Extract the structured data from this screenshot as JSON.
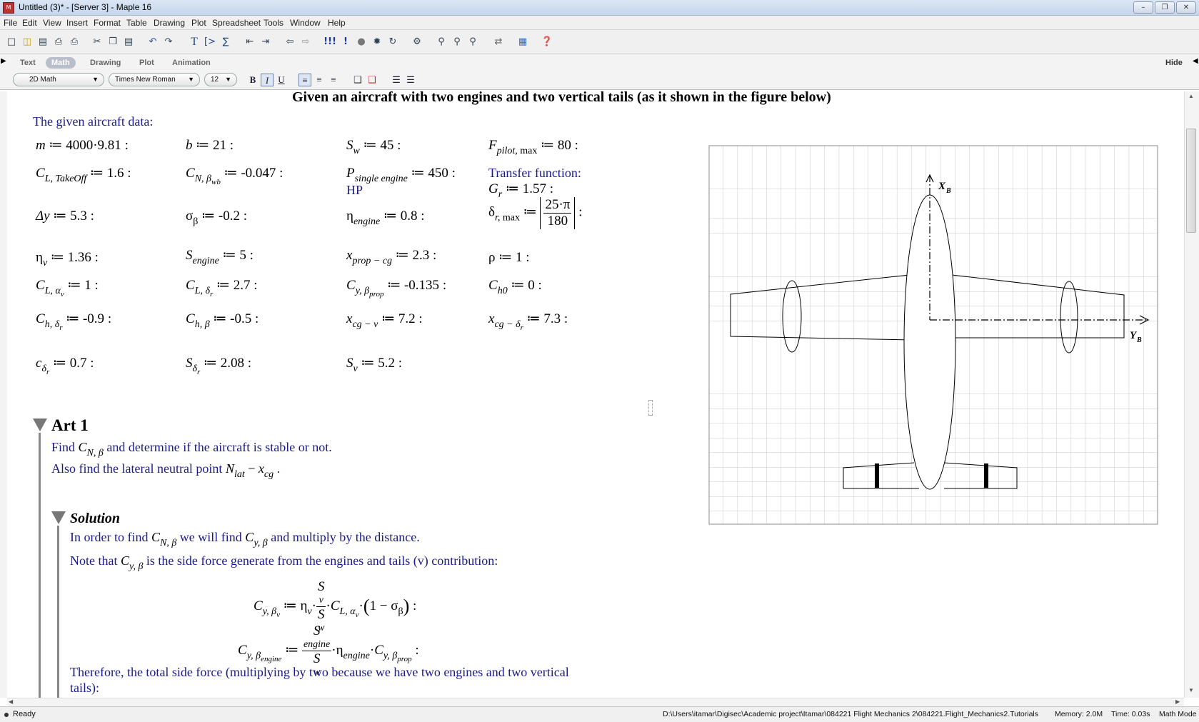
{
  "window": {
    "title": "Untitled (3)* - [Server 3] - Maple 16",
    "minimize": "–",
    "restore": "❐",
    "close": "✕"
  },
  "menu": [
    "File",
    "Edit",
    "View",
    "Insert",
    "Format",
    "Table",
    "Drawing",
    "Plot",
    "Spreadsheet",
    "Tools",
    "Window",
    "Help"
  ],
  "toolbar_icons": [
    "new-icon",
    "open-icon",
    "save-icon",
    "print-preview-icon",
    "print-icon",
    "cut-icon",
    "copy-icon",
    "paste-icon",
    "undo-icon",
    "redo-icon",
    "text-icon",
    "math-prompt-icon",
    "sum-icon",
    "indent-icon",
    "outdent-icon",
    "back-icon",
    "forward-icon",
    "execute-all-icon",
    "execute-icon",
    "stop-icon",
    "debug-icon",
    "restart-icon",
    "settings-icon",
    "zoom-100-icon",
    "zoom-150-icon",
    "zoom-200-icon",
    "toggle-icon",
    "maplet-icon",
    "help-icon"
  ],
  "palette": {
    "tabs": [
      "Text",
      "Math",
      "Drawing",
      "Plot",
      "Animation"
    ],
    "active_tab": "Math",
    "hide": "Hide",
    "style": "2D Math",
    "font": "Times New Roman",
    "size": "12",
    "bold": "B",
    "italic": "I",
    "underline": "U"
  },
  "document": {
    "title": "Given an aircraft with two engines and two vertical tails (as it shown in the figure below)",
    "given_label": "The given aircraft data:",
    "transfer_label": "Transfer function:",
    "hp_unit": "HP",
    "section_title": "Art 1",
    "find_text": "and determine if the aircraft is stable or not.",
    "find_prefix": "Find",
    "also_text": "Also find the lateral neutral point",
    "solution_title": "Solution",
    "sol_line1_a": "In order to find",
    "sol_line1_b": "we will find",
    "sol_line1_c": "and multiply by the distance.",
    "sol_line2_a": "Note that",
    "sol_line2_b": "is the side force generate from the engines and tails (v) contribution:",
    "therefore": "Therefore, the total side force (multiplying by two because we have two engines and two vertical",
    "therefore2": "tails):"
  },
  "values": {
    "m": "4000·9.81",
    "b": "21",
    "Sw": "45",
    "Fpilot": "80",
    "CLTakeOff": "1.6",
    "CNbwb": "-0.047",
    "Psingle": "450",
    "Gr": "1.57",
    "dy": "5.3",
    "sigma": "-0.2",
    "eta_engine": "0.8",
    "dr_num": "25·π",
    "dr_den": "180",
    "eta_v": "1.36",
    "S_engine": "5",
    "x_prop": "2.3",
    "rho": "1",
    "CLav": "1",
    "CLdr": "2.7",
    "Cybprop": "-0.135",
    "Ch0": "0",
    "Chdr": "-0.9",
    "Chb": "-0.5",
    "xcgv": "7.2",
    "xcgdr": "7.3",
    "cdr": "0.7",
    "Sdr": "2.08",
    "Sv": "5.2"
  },
  "figure": {
    "x_axis_label": "X",
    "x_axis_sub": "B",
    "y_axis_label": "Y",
    "y_axis_sub": "B"
  },
  "status": {
    "ready": "Ready",
    "path": "D:\\Users\\itamar\\Digisec\\Academic project\\Itamar\\084221 Flight Mechanics 2\\084221.Flight_Mechanics2.Tutorials",
    "memory": "Memory: 2.0M",
    "time": "Time: 0.03s",
    "mode": "Math Mode"
  }
}
